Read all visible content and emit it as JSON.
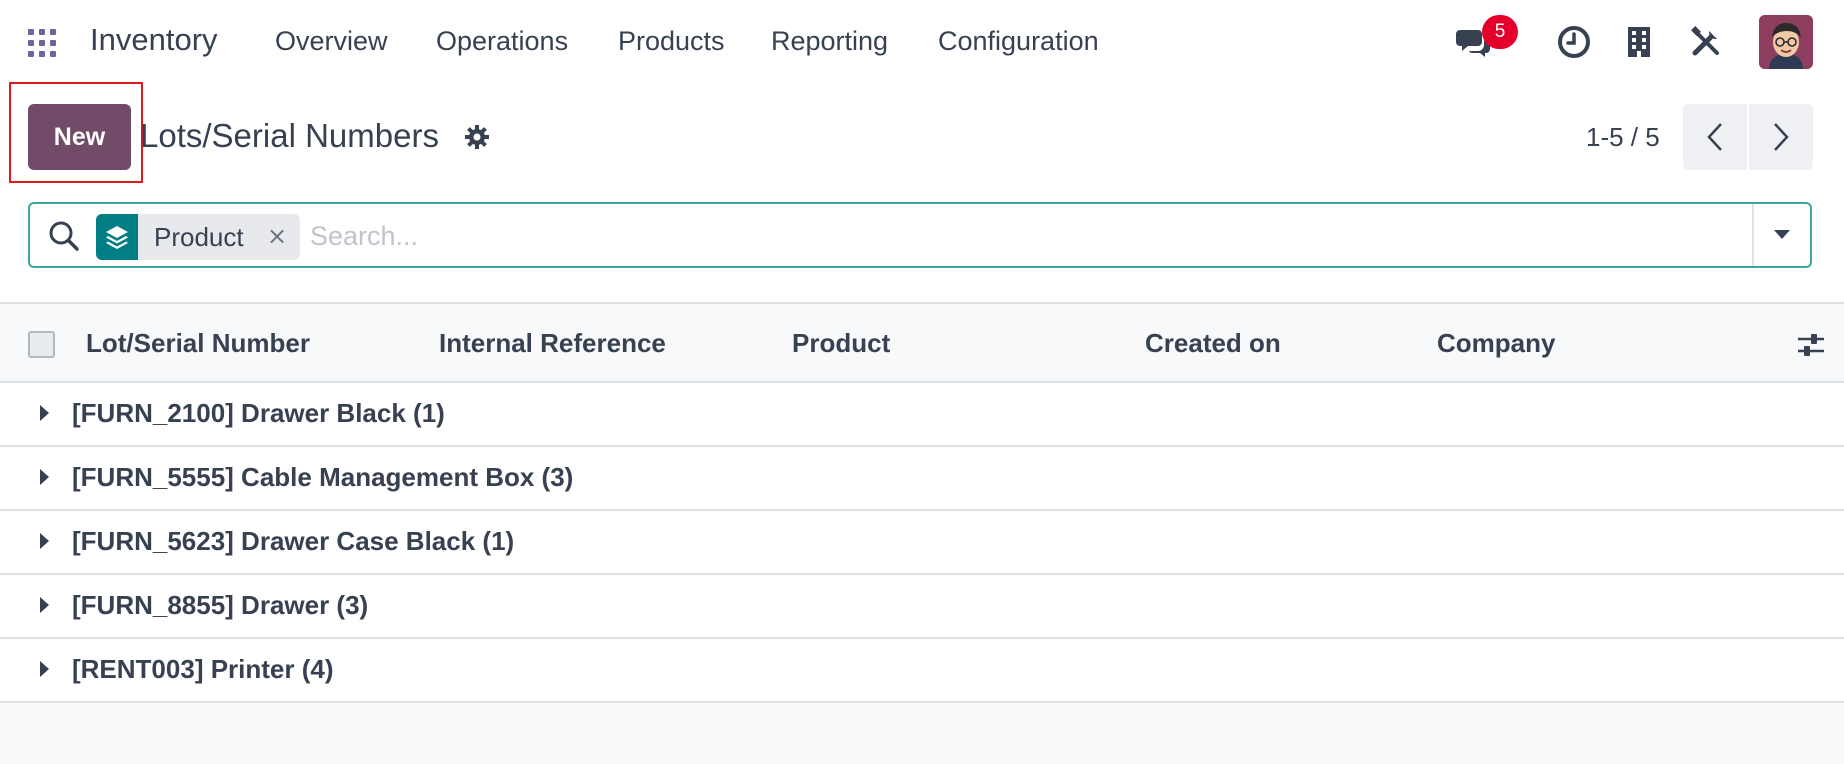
{
  "navbar": {
    "app_title": "Inventory",
    "menus": [
      "Overview",
      "Operations",
      "Products",
      "Reporting",
      "Configuration"
    ],
    "message_badge": "5",
    "icons": [
      "apps-grid-icon",
      "chat-icon",
      "clock-icon",
      "building-icon",
      "tools-icon",
      "user-avatar"
    ]
  },
  "control_panel": {
    "new_label": "New",
    "title": "Lots/Serial Numbers",
    "pager": "1-5 / 5"
  },
  "search": {
    "facet_label": "Product",
    "facet_remove": "×",
    "placeholder": "Search..."
  },
  "table": {
    "columns": [
      "Lot/Serial Number",
      "Internal Reference",
      "Product",
      "Created on",
      "Company"
    ],
    "groups": [
      "[FURN_2100] Drawer Black (1)",
      "[FURN_5555] Cable Management Box (3)",
      "[FURN_5623] Drawer Case Black (1)",
      "[FURN_8855] Drawer (3)",
      "[RENT003] Printer (4)"
    ]
  },
  "colors": {
    "brand": "#714b67",
    "accent_teal": "#017e84",
    "badge_red": "#e4002b",
    "highlight_red": "#e0191c"
  }
}
